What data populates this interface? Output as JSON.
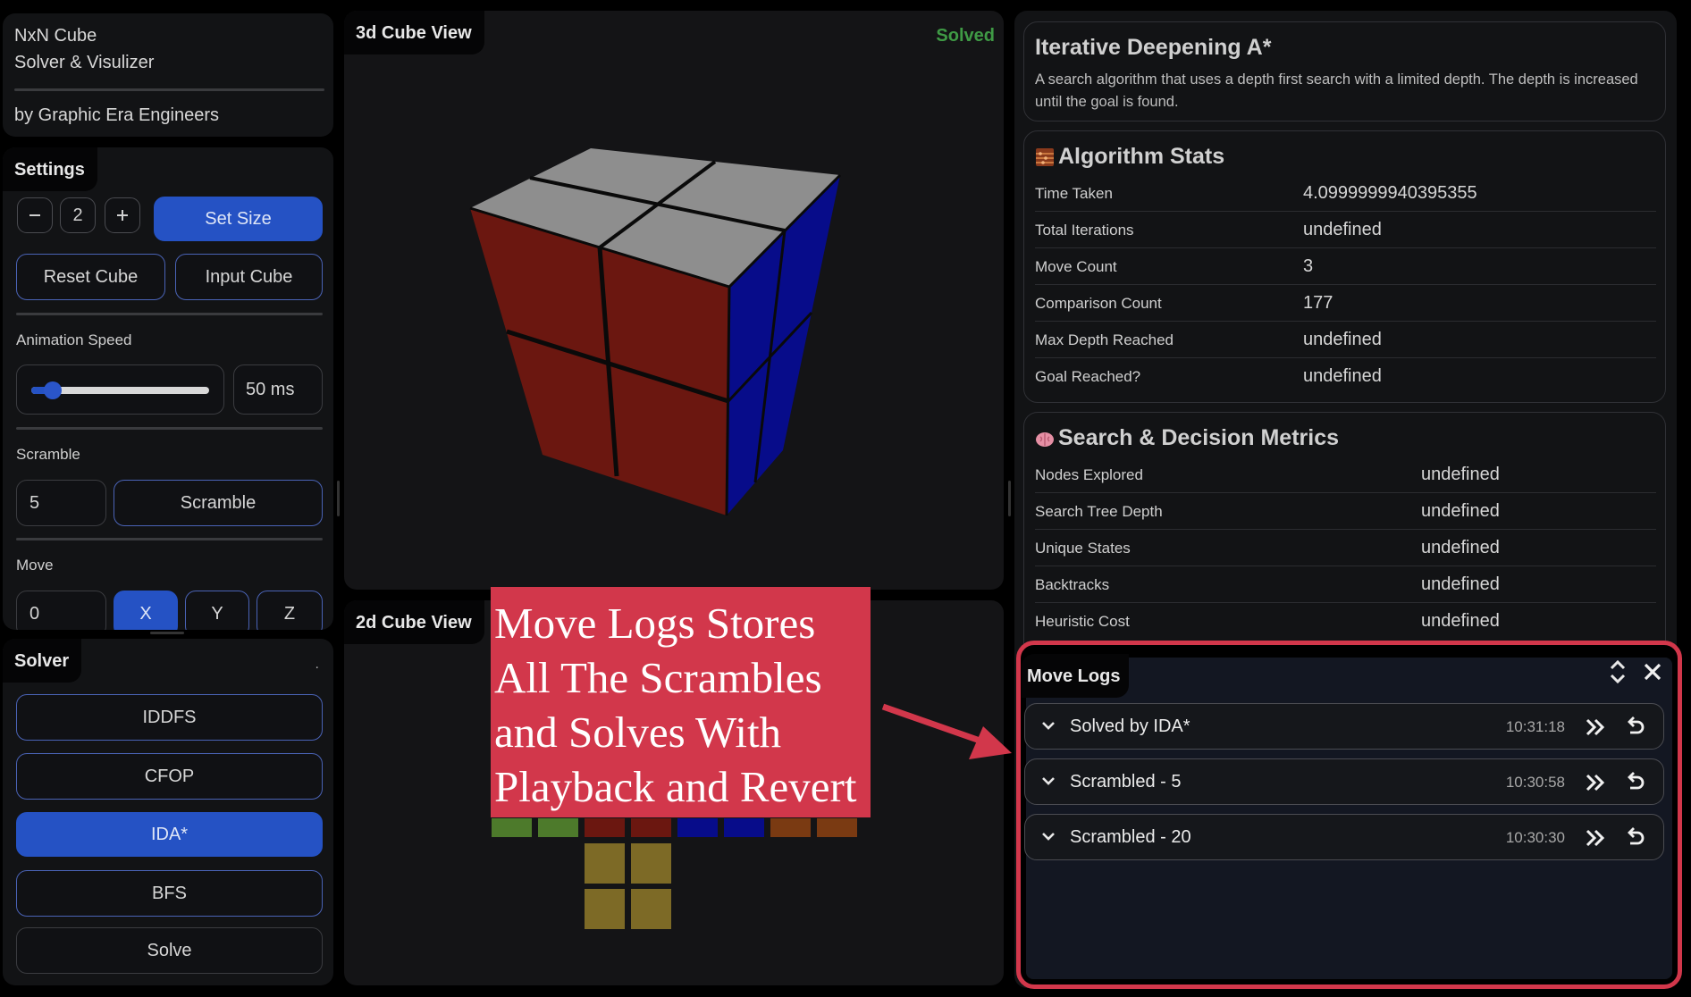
{
  "header": {
    "title_line1": "NxN Cube",
    "title_line2": "Solver & Visulizer",
    "byline": "by Graphic Era Engineers"
  },
  "settings": {
    "title": "Settings",
    "size_value": "2",
    "set_size_label": "Set Size",
    "reset_label": "Reset Cube",
    "input_label": "Input Cube",
    "animation_speed_label": "Animation Speed",
    "animation_speed_value": "50 ms",
    "animation_speed_fraction": 0.12,
    "scramble_label": "Scramble",
    "scramble_count": "5",
    "scramble_button": "Scramble",
    "move_label": "Move",
    "move_value": "0",
    "axis_x": "X",
    "axis_y": "Y",
    "axis_z": "Z"
  },
  "solver": {
    "title": "Solver",
    "dot": ".",
    "options": [
      "IDDFS",
      "CFOP",
      "IDA*",
      "BFS",
      "Solve"
    ],
    "selected": "IDA*"
  },
  "view3d": {
    "title": "3d Cube View",
    "status": "Solved"
  },
  "view2d": {
    "title": "2d Cube View"
  },
  "algorithm": {
    "title": "Iterative Deepening A*",
    "description": "A search algorithm that uses a depth first search with a limited depth. The depth is increased until the goal is found."
  },
  "stats": {
    "title": "Algorithm Stats",
    "rows": [
      {
        "key": "Time Taken",
        "value": "4.0999999940395355"
      },
      {
        "key": "Total Iterations",
        "value": "undefined"
      },
      {
        "key": "Move Count",
        "value": "3"
      },
      {
        "key": "Comparison Count",
        "value": "177"
      },
      {
        "key": "Max Depth Reached",
        "value": "undefined"
      },
      {
        "key": "Goal Reached?",
        "value": "undefined"
      }
    ]
  },
  "metrics": {
    "title": "Search & Decision Metrics",
    "rows": [
      {
        "key": "Nodes Explored",
        "value": "undefined"
      },
      {
        "key": "Search Tree Depth",
        "value": "undefined"
      },
      {
        "key": "Unique States",
        "value": "undefined"
      },
      {
        "key": "Backtracks",
        "value": "undefined"
      },
      {
        "key": "Heuristic Cost",
        "value": "undefined"
      }
    ]
  },
  "move_logs": {
    "title": "Move Logs",
    "items": [
      {
        "name": "Solved by IDA*",
        "time": "10:31:18"
      },
      {
        "name": "Scrambled - 5",
        "time": "10:30:58"
      },
      {
        "name": "Scrambled - 20",
        "time": "10:30:30"
      }
    ]
  },
  "annotation": {
    "lines": [
      "Move Logs Stores",
      "All The Scrambles",
      "and Solves With",
      "Playback and Revert"
    ]
  },
  "colors": {
    "accent": "#2552c4",
    "solved": "#3f9a45",
    "annotation_bg": "#d2374b",
    "face_top": "#8e8e8e",
    "face_front": "#6b1710",
    "face_right": "#070c8a",
    "face_green": "#4d7a2b",
    "face_red": "#6b1710",
    "face_blue": "#070c8a",
    "face_orange": "#7a3a12",
    "face_yellow": "#7d6a26"
  }
}
